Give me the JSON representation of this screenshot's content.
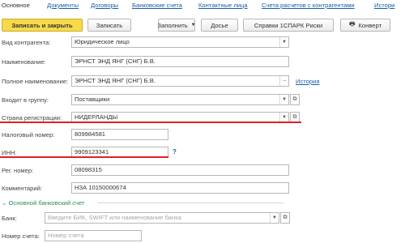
{
  "tabs": [
    {
      "label": "Основное",
      "active": true
    },
    {
      "label": "Документы"
    },
    {
      "label": "Договоры"
    },
    {
      "label": "Банковские счета"
    },
    {
      "label": "Контактные лица"
    },
    {
      "label": "Счета расчетов с контрагентами"
    },
    {
      "label": "Истори"
    }
  ],
  "toolbar": {
    "save_close": "Записать и закрыть",
    "save": "Записать",
    "fill": "Заполнить",
    "dossier": "Досье",
    "spark": "Справки 1СПАРК Риски",
    "envelope": "Конверт"
  },
  "form": {
    "kind": {
      "label": "Вид контрагента:",
      "value": "Юридическое лицо"
    },
    "name": {
      "label": "Наименование:",
      "value": "ЭРНСТ ЭНД ЯНГ (СНГ) Б.В."
    },
    "full_name": {
      "label": "Полное наименование:",
      "value": "ЭРНСТ ЭНД ЯНГ (СНГ) Б.В.",
      "history_link": "История"
    },
    "group": {
      "label": "Входит в группу:",
      "value": "Поставщики"
    },
    "country": {
      "label": "Страна регистрации:",
      "value": "НИДЕРЛАНДЫ"
    },
    "tax_no": {
      "label": "Налоговый номер:",
      "value": "809984581"
    },
    "inn": {
      "label": "ИНН:",
      "value": "9909123341",
      "help": "?"
    },
    "reg_no": {
      "label": "Рег. номер:",
      "value": "08098315"
    },
    "comment": {
      "label": "Комментарий:",
      "value": "НЗА 10150000674"
    }
  },
  "bank_section": {
    "title": "Основной банковский счет",
    "bank": {
      "label": "Банк:",
      "placeholder": "Введите БИК, SWIFT или наименование банка"
    },
    "account": {
      "label": "Номер счета:",
      "placeholder": "Номер счета"
    }
  },
  "colors": {
    "accent_link": "#1a5ea8",
    "primary_button": "#f7d94a",
    "annotation": "#e02020",
    "section": "#2e8b57"
  }
}
